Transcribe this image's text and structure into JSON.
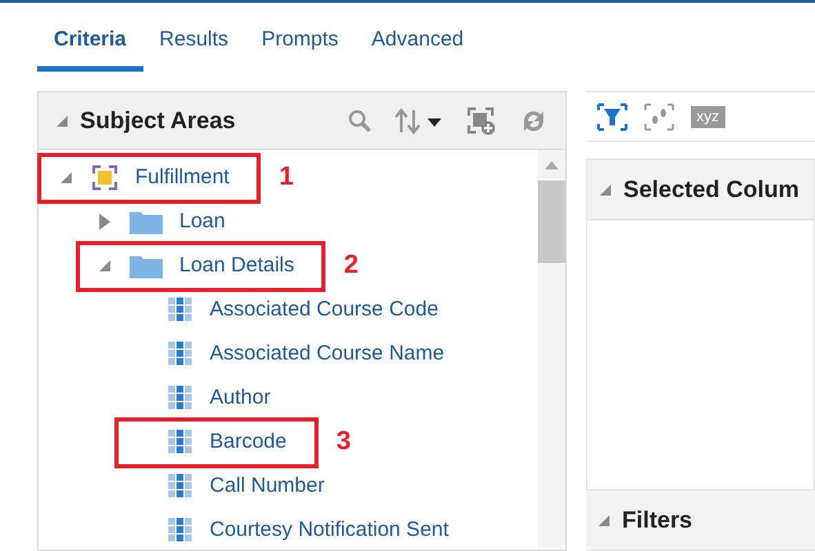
{
  "tabs": [
    {
      "label": "Criteria",
      "selected": true
    },
    {
      "label": "Results",
      "selected": false
    },
    {
      "label": "Prompts",
      "selected": false
    },
    {
      "label": "Advanced",
      "selected": false
    }
  ],
  "subject_areas": {
    "title": "Subject Areas",
    "expanded": true,
    "tree": [
      {
        "kind": "subject-area",
        "label": "Fulfillment",
        "expanded": true,
        "callout": "1",
        "children": [
          {
            "kind": "folder",
            "label": "Loan",
            "expanded": false
          },
          {
            "kind": "folder",
            "label": "Loan Details",
            "expanded": true,
            "callout": "2",
            "children": [
              {
                "kind": "column",
                "label": "Associated Course Code"
              },
              {
                "kind": "column",
                "label": "Associated Course Name"
              },
              {
                "kind": "column",
                "label": "Author"
              },
              {
                "kind": "column",
                "label": "Barcode",
                "callout": "3"
              },
              {
                "kind": "column",
                "label": "Call Number"
              },
              {
                "kind": "column",
                "label": "Courtesy Notification Sent"
              }
            ]
          }
        ]
      }
    ]
  },
  "criteria_toolbar": {
    "xyz_label": "xyz"
  },
  "sections": [
    {
      "title": "Selected Colum",
      "expanded": true
    },
    {
      "title": "Filters",
      "expanded": true
    }
  ]
}
